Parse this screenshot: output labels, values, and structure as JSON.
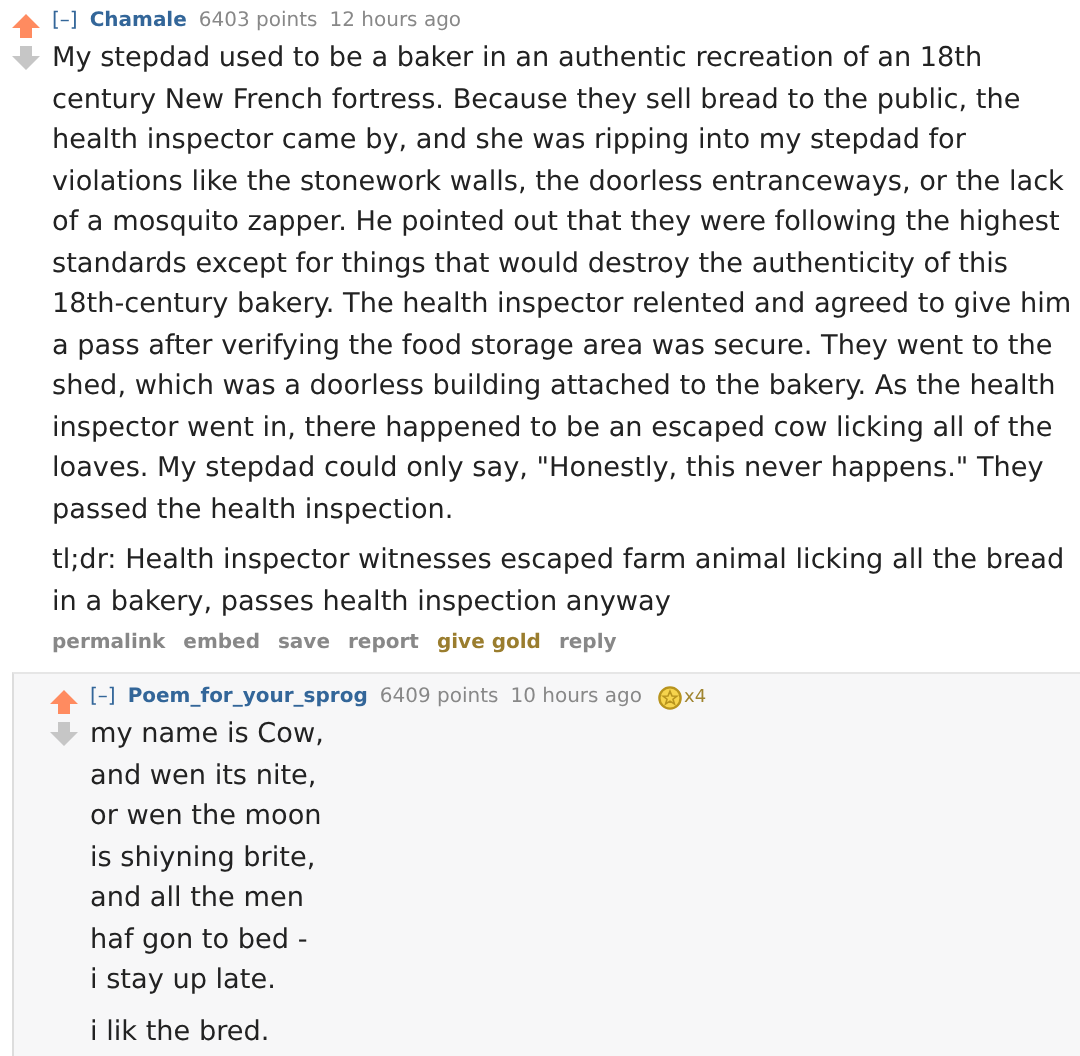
{
  "comment": {
    "upvoted": true,
    "downvoted": false,
    "collapse": "[–]",
    "author": "Chamale",
    "points": "6403 points",
    "time": "12 hours ago",
    "paragraphs": [
      "My stepdad used to be a baker in an authentic recreation of an 18th century New French fortress. Because they sell bread to the public, the health inspector came by, and she was ripping into my stepdad for violations like the stonework walls, the doorless entranceways, or the lack of a mosquito zapper. He pointed out that they were following the highest standards except for things that would destroy the authenticity of this 18th-century bakery. The health inspector relented and agreed to give him a pass after verifying the food storage area was secure. They went to the shed, which was a doorless building attached to the bakery. As the health inspector went in, there happened to be an escaped cow licking all of the loaves. My stepdad could only say, \"Honestly, this never happens.\" They passed the health inspection.",
      "tl;dr: Health inspector witnesses escaped farm animal licking all the bread in a bakery, passes health inspection anyway"
    ],
    "actions": [
      {
        "label": "permalink",
        "kind": "plain"
      },
      {
        "label": "embed",
        "kind": "plain"
      },
      {
        "label": "save",
        "kind": "plain"
      },
      {
        "label": "report",
        "kind": "plain"
      },
      {
        "label": "give gold",
        "kind": "gold"
      },
      {
        "label": "reply",
        "kind": "plain"
      }
    ],
    "reply": {
      "upvoted": true,
      "downvoted": false,
      "collapse": "[–]",
      "author": "Poem_for_your_sprog",
      "points": "6409 points",
      "time": "10 hours ago",
      "gilded": "x4",
      "paragraphs": [
        "my name is Cow,\nand wen its nite,\nor wen the moon\nis shiyning brite,\nand all the men\nhaf gon to bed -\ni stay up late.",
        "i lik the bred."
      ]
    }
  }
}
